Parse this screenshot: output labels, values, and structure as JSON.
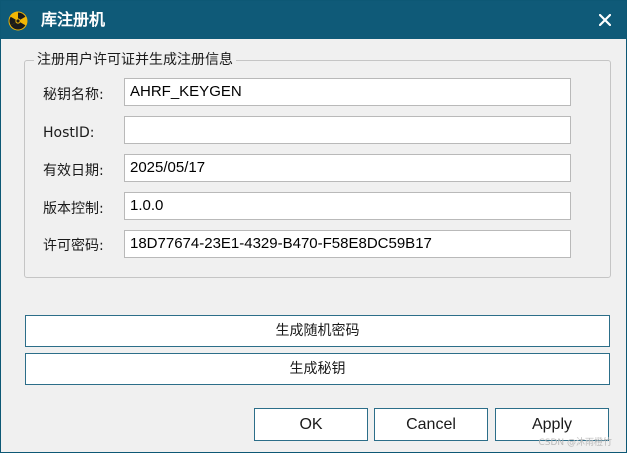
{
  "window": {
    "title": "库注册机",
    "close_glyph": "✕"
  },
  "group": {
    "title": "注册用户许可证并生成注册信息",
    "fields": [
      {
        "label": "秘钥名称:",
        "value": "AHRF_KEYGEN"
      },
      {
        "label": "HostID:",
        "value": ""
      },
      {
        "label": "有效日期:",
        "value": "2025/05/17"
      },
      {
        "label": "版本控制:",
        "value": "1.0.0"
      },
      {
        "label": "许可密码:",
        "value": "18D77674-23E1-4329-B470-F58E8DC59B17"
      }
    ]
  },
  "actions": {
    "generate_random_password": "生成随机密码",
    "generate_key": "生成秘钥"
  },
  "dialog_buttons": {
    "ok": "OK",
    "cancel": "Cancel",
    "apply": "Apply"
  },
  "watermark": "CSDN @沐雨橙竹",
  "colors": {
    "titlebar": "#0f5a78",
    "button_border": "#2c6e89",
    "icon_yellow": "#f2b705"
  },
  "icons": {
    "app": "radiation-icon",
    "close": "close-icon"
  }
}
